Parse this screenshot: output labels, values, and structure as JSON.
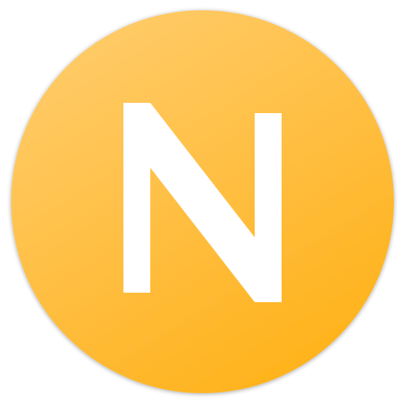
{
  "app_icon": {
    "icon": "n-letter-icon",
    "letter": "N",
    "colors": {
      "background_light": "#FFCA66",
      "background_dark": "#FFB21A",
      "letter": "#FFFFFF"
    }
  }
}
